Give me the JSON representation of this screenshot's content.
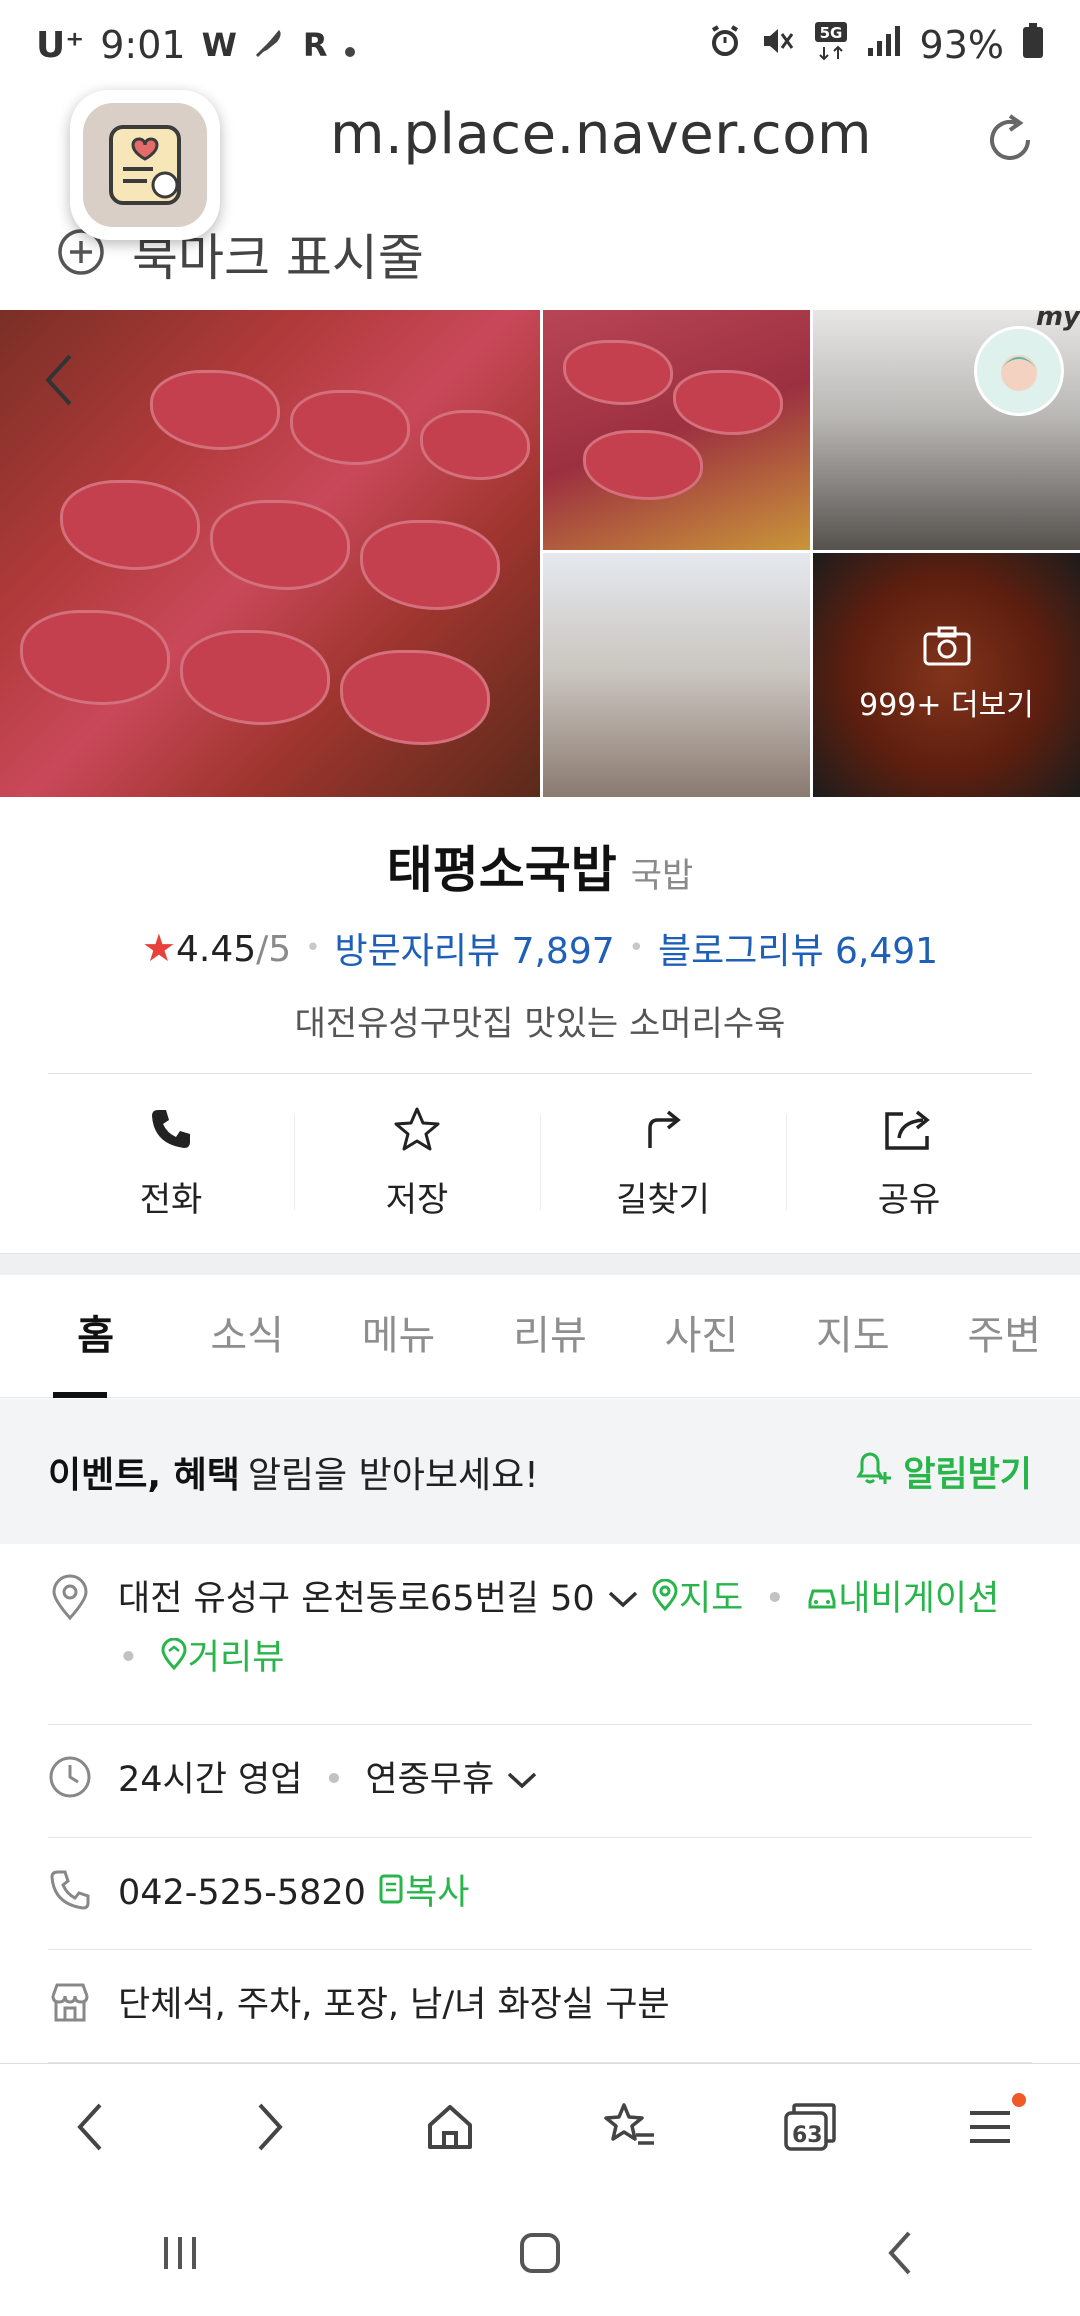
{
  "status_bar": {
    "carrier": "U⁺",
    "time": "9:01",
    "left_glyphs": [
      "W",
      "R"
    ],
    "right_icons": [
      "alarm-icon",
      "mute-icon",
      "5g-icon",
      "signal-icon",
      "battery-icon"
    ],
    "network": "5G",
    "battery_percent": "93%"
  },
  "browser": {
    "url": "m.place.naver.com",
    "bookmark_label": "북마크 표시줄"
  },
  "photos": {
    "more_label": "999+ 더보기",
    "my_badge": "my"
  },
  "place": {
    "name": "태평소국밥",
    "category": "국밥",
    "rating": "4.45",
    "rating_scale": "/5",
    "visitor_reviews": "방문자리뷰 7,897",
    "blog_reviews": "블로그리뷰 6,491",
    "description": "대전유성구맛집 맛있는 소머리수육"
  },
  "actions": [
    {
      "label": "전화",
      "icon": "phone-icon"
    },
    {
      "label": "저장",
      "icon": "star-outline-icon"
    },
    {
      "label": "길찾기",
      "icon": "directions-icon"
    },
    {
      "label": "공유",
      "icon": "share-icon"
    }
  ],
  "tabs": [
    "홈",
    "소식",
    "메뉴",
    "리뷰",
    "사진",
    "지도",
    "주변"
  ],
  "active_tab": "홈",
  "notice": {
    "bold": "이벤트, 혜택",
    "text": "알림을 받아보세요!",
    "action": "알림받기"
  },
  "info": {
    "address": "대전 유성구 온천동로65번길 50",
    "map_link": "지도",
    "navigation_link": "내비게이션",
    "street_view_link": "거리뷰",
    "hours": "24시간 영업",
    "hours_note": "연중무휴",
    "phone": "042-525-5820",
    "copy_label": "복사",
    "amenities": "단체석, 주차, 포장, 남/녀 화장실 구분"
  },
  "toolbar": {
    "tab_count": "63"
  },
  "colors": {
    "link_blue": "#1e5fb8",
    "naver_green": "#28b54a",
    "star_red": "#e8403a",
    "notification_dot": "#f05a28"
  }
}
